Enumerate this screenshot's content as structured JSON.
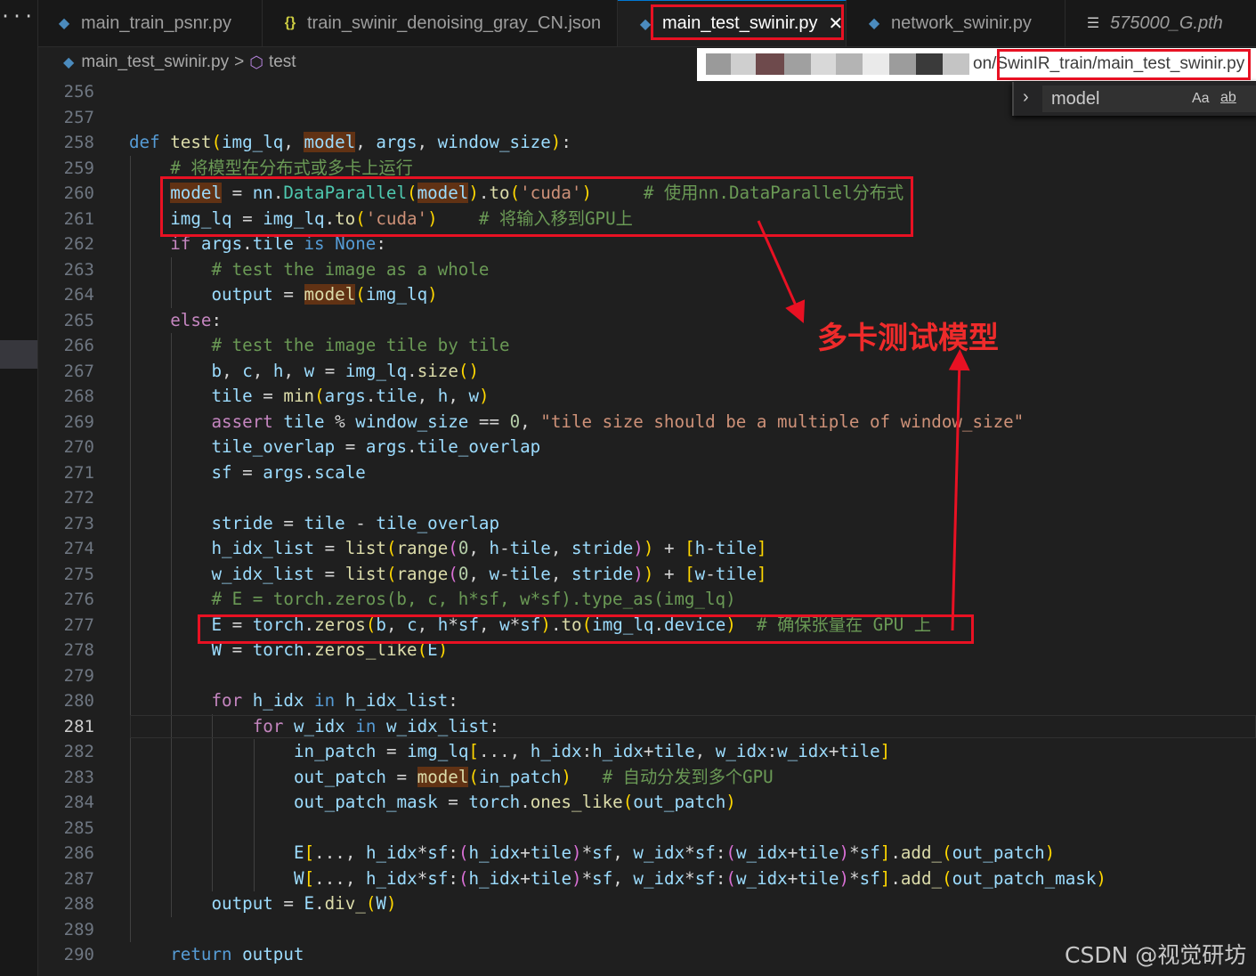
{
  "tabs": [
    {
      "label": "main_train_psnr.py",
      "icon": "python-icon",
      "active": false
    },
    {
      "label": "train_swinir_denoising_gray_CN.json",
      "icon": "json-icon",
      "active": false
    },
    {
      "label": "main_test_swinir.py",
      "icon": "python-icon",
      "active": true
    },
    {
      "label": "network_swinir.py",
      "icon": "python-icon",
      "active": false
    },
    {
      "label": "575000_G.pth",
      "icon": "file-lines-icon",
      "active": false
    }
  ],
  "breadcrumb": {
    "file": "main_test_swinir.py",
    "separator": ">",
    "symbol": "test"
  },
  "path_tooltip": {
    "visible_text": "on/SwinIR_train/main_test_swinir.py"
  },
  "find_widget": {
    "query": "model",
    "match_case_label": "Aa",
    "whole_word_label": "ab"
  },
  "editor": {
    "current_line": 281,
    "line_numbers": [
      "256",
      "257",
      "258",
      "259",
      "260",
      "261",
      "262",
      "263",
      "264",
      "265",
      "266",
      "267",
      "268",
      "269",
      "270",
      "271",
      "272",
      "273",
      "274",
      "275",
      "276",
      "277",
      "278",
      "279",
      "280",
      "281",
      "282",
      "283",
      "284",
      "285",
      "286",
      "287",
      "288",
      "289",
      "290"
    ],
    "code_lines": [
      "",
      "",
      "def test(img_lq, model, args, window_size):",
      "    # 将模型在分布式或多卡上运行",
      "    model = nn.DataParallel(model).to('cuda')     # 使用nn.DataParallel分布式",
      "    img_lq = img_lq.to('cuda')    # 将输入移到GPU上",
      "    if args.tile is None:",
      "        # test the image as a whole",
      "        output = model(img_lq)",
      "    else:",
      "        # test the image tile by tile",
      "        b, c, h, w = img_lq.size()",
      "        tile = min(args.tile, h, w)",
      "        assert tile % window_size == 0, \"tile size should be a multiple of window_size\"",
      "        tile_overlap = args.tile_overlap",
      "        sf = args.scale",
      "",
      "        stride = tile - tile_overlap",
      "        h_idx_list = list(range(0, h-tile, stride)) + [h-tile]",
      "        w_idx_list = list(range(0, w-tile, stride)) + [w-tile]",
      "        # E = torch.zeros(b, c, h*sf, w*sf).type_as(img_lq)",
      "        E = torch.zeros(b, c, h*sf, w*sf).to(img_lq.device)  # 确保张量在 GPU 上",
      "        W = torch.zeros_like(E)",
      "",
      "        for h_idx in h_idx_list:",
      "            for w_idx in w_idx_list:",
      "                in_patch = img_lq[..., h_idx:h_idx+tile, w_idx:w_idx+tile]",
      "                out_patch = model(in_patch)   # 自动分发到多个GPU",
      "                out_patch_mask = torch.ones_like(out_patch)",
      "",
      "                E[..., h_idx*sf:(h_idx+tile)*sf, w_idx*sf:(w_idx+tile)*sf].add_(out_patch)",
      "                W[..., h_idx*sf:(h_idx+tile)*sf, w_idx*sf:(w_idx+tile)*sf].add_(out_patch_mask)",
      "        output = E.div_(W)",
      "",
      "    return output"
    ]
  },
  "annotation": {
    "label": "多卡测试模型",
    "color": "#ef2b2b"
  },
  "watermark": "CSDN @视觉研坊"
}
